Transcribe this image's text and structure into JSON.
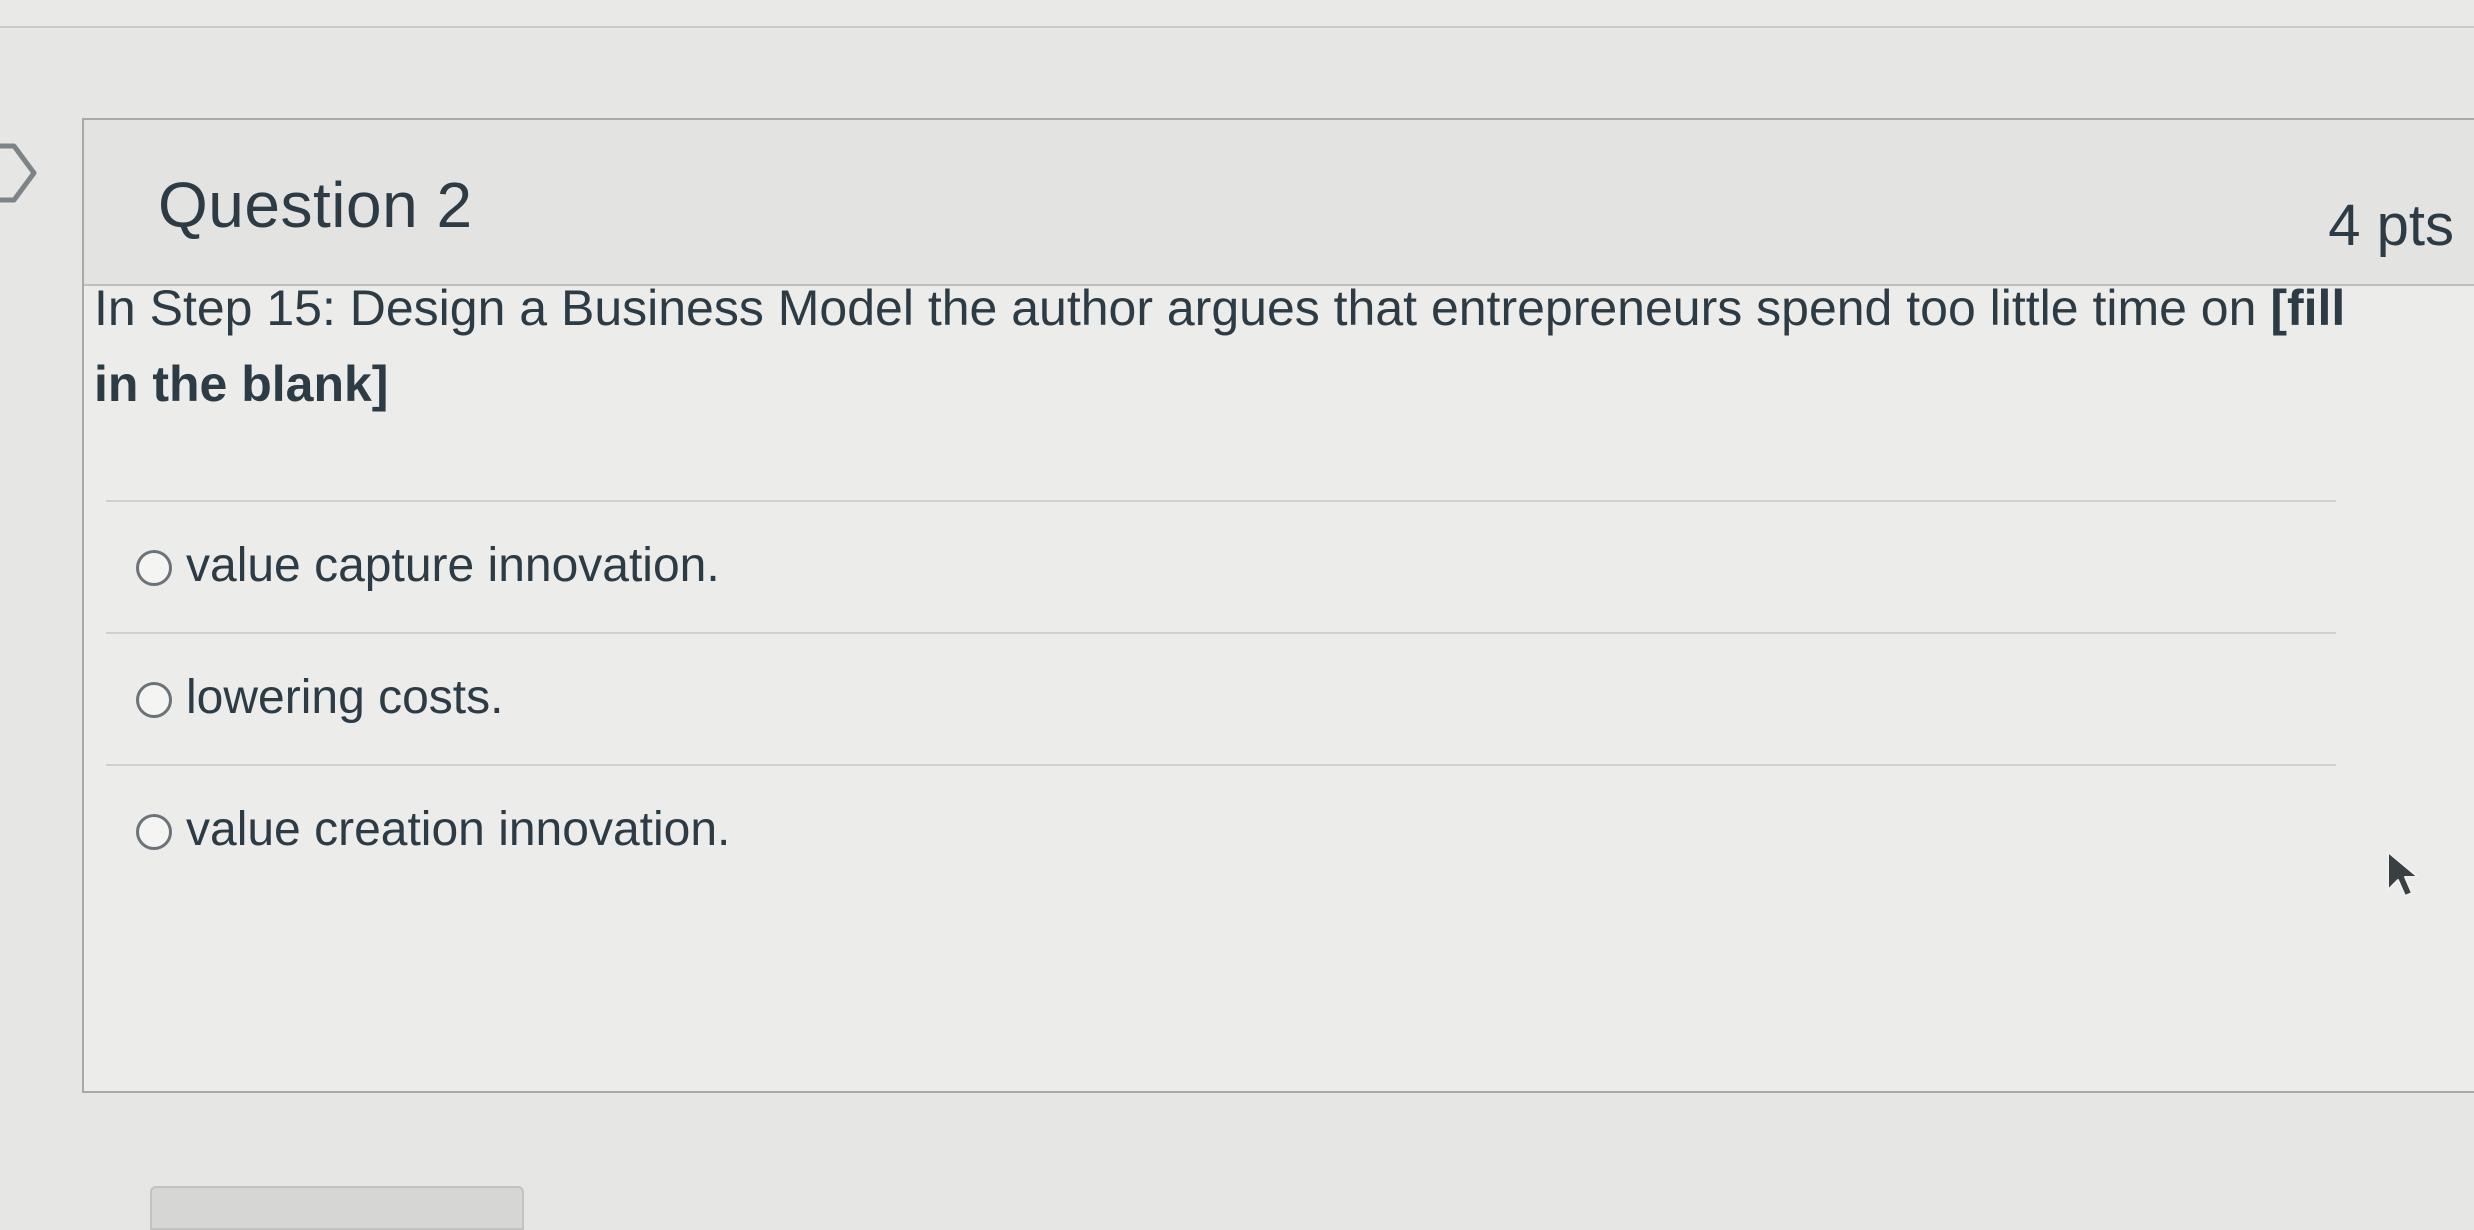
{
  "question": {
    "title": "Question 2",
    "points": "4 pts",
    "stem": "In Step 15: Design a Business Model the author argues that entrepreneurs spend too little time on ",
    "blank": "[fill in the blank]"
  },
  "answers": [
    {
      "label": "value capture innovation.",
      "selected": false
    },
    {
      "label": "lowering costs.",
      "selected": false
    },
    {
      "label": "value creation innovation.",
      "selected": false
    }
  ],
  "colors": {
    "text": "#2d3b45",
    "border": "#a8aaa8",
    "background": "#e6e6e4"
  },
  "icons": {
    "flag": "flag-icon",
    "cursor": "mouse-cursor-icon"
  }
}
